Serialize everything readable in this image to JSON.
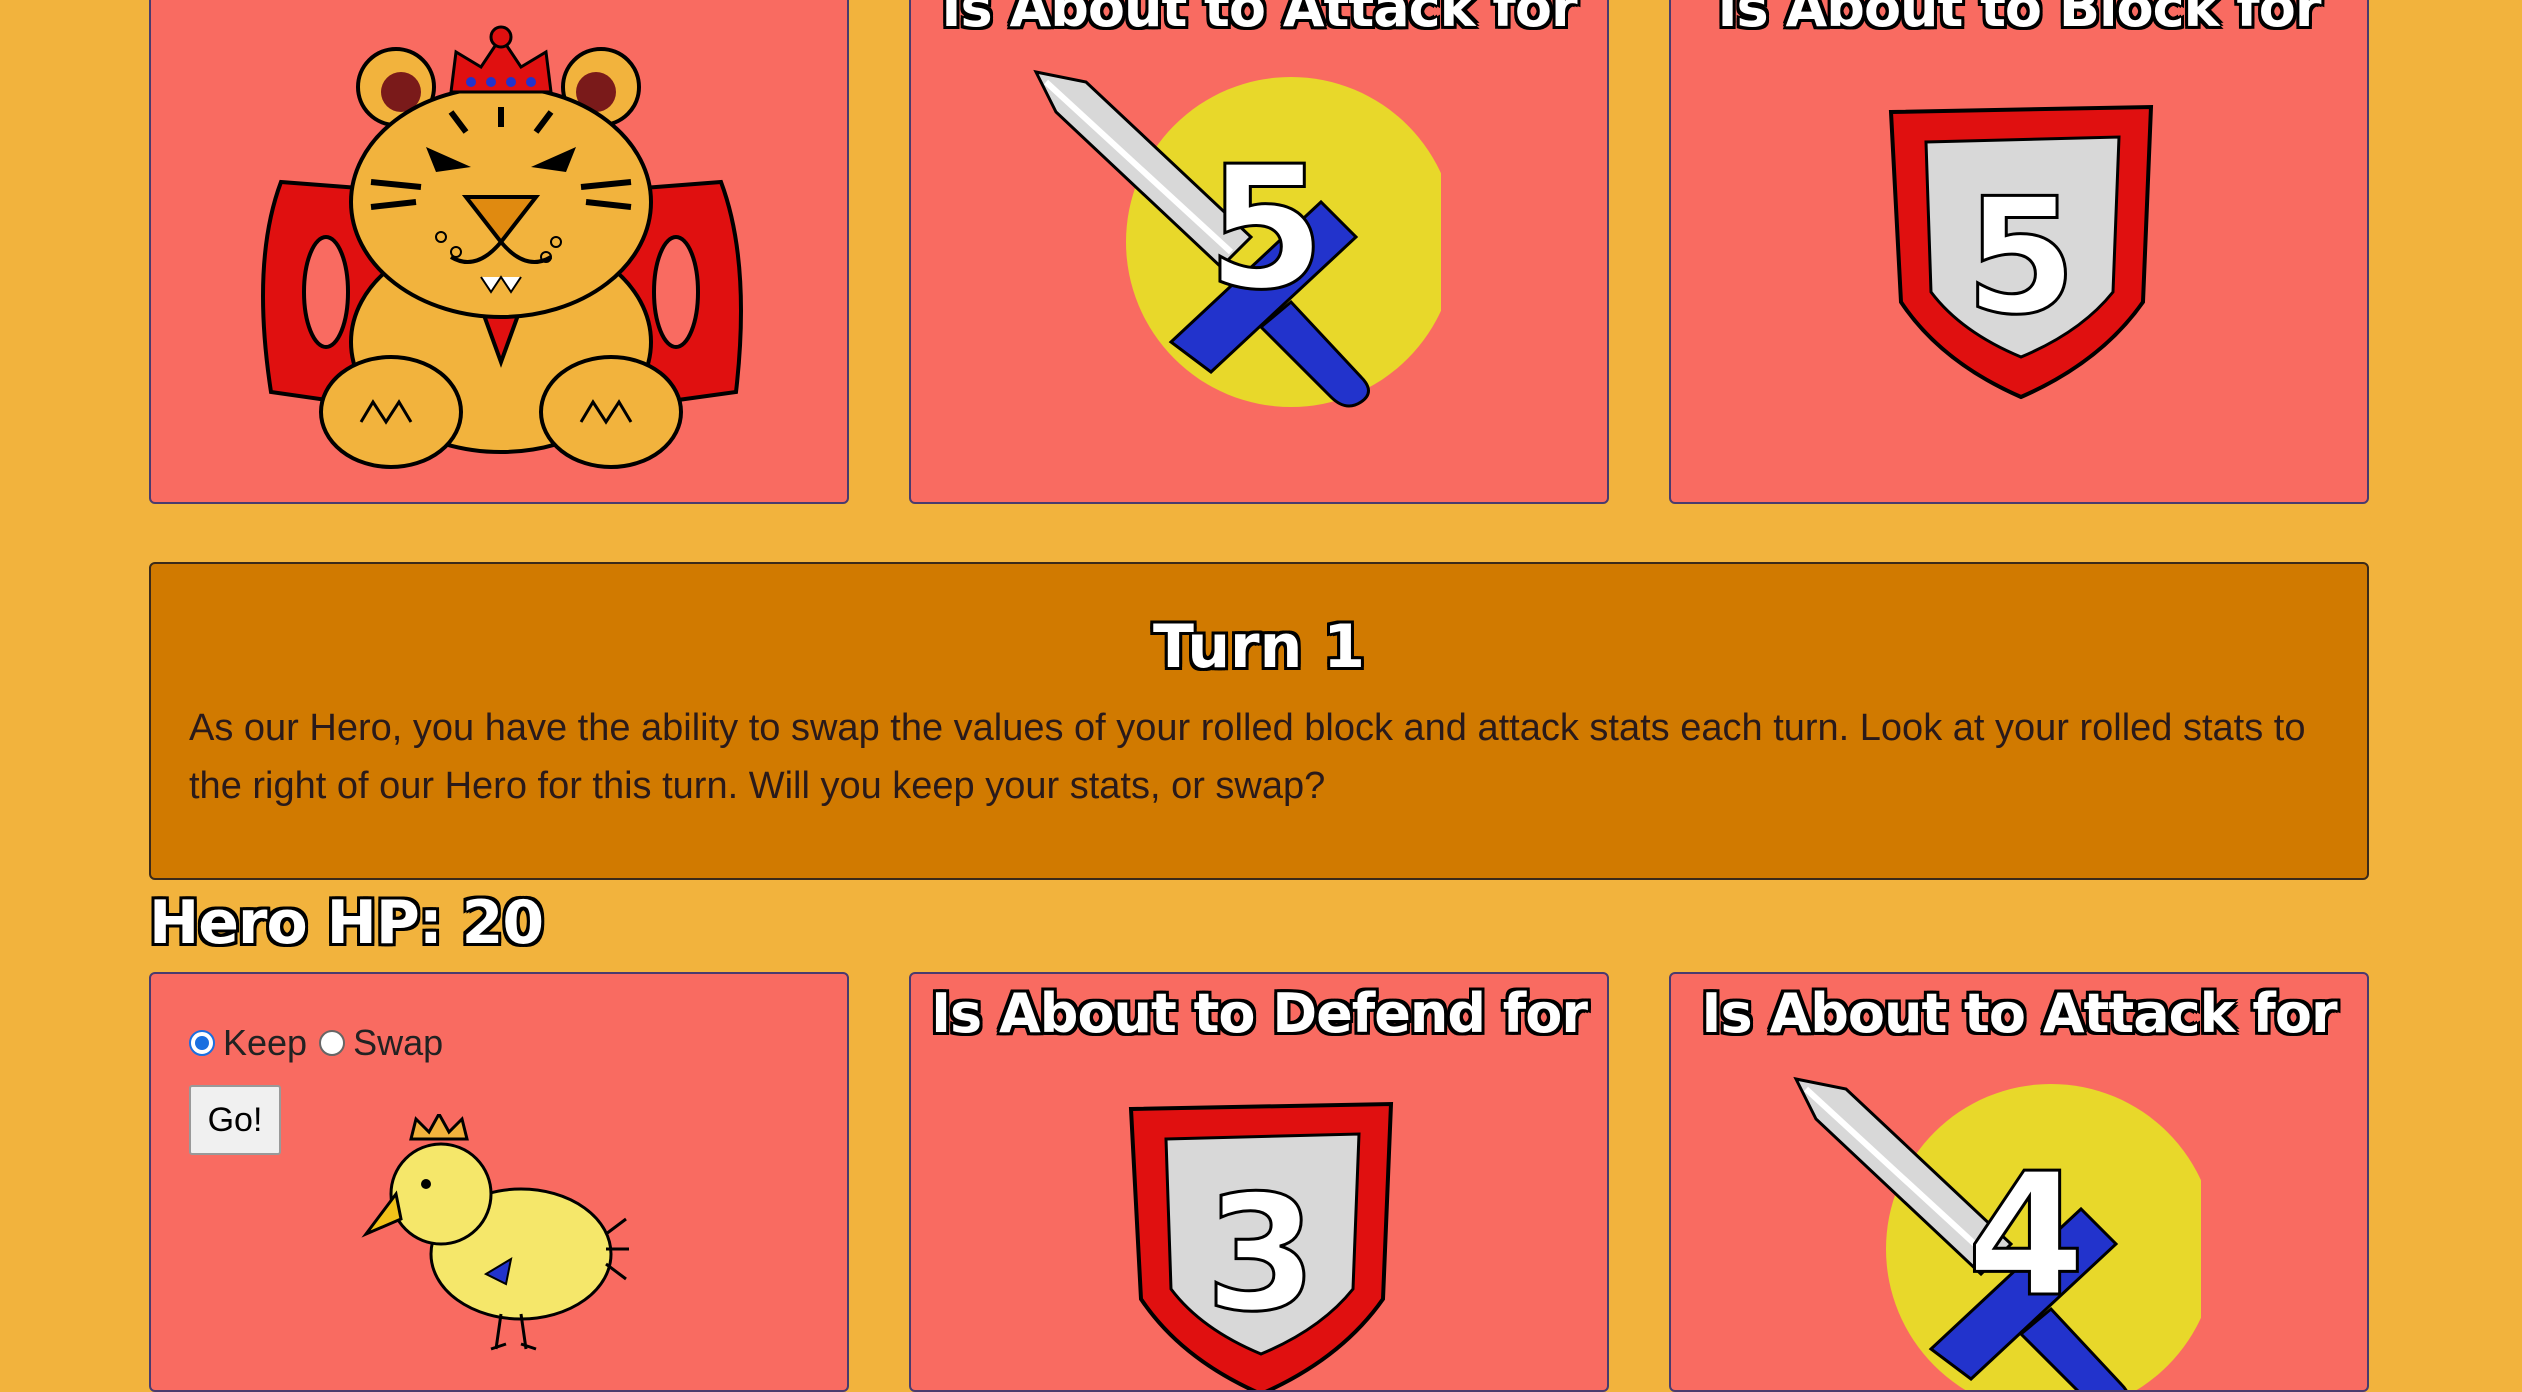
{
  "enemy": {
    "attack_title": "Is About to Attack for",
    "attack_value": "5",
    "block_title": "Is About to Block for",
    "block_value": "5"
  },
  "turn": {
    "title": "Turn 1",
    "text": "As our Hero, you have the ability to swap the values of your rolled block and attack stats each turn. Look at your rolled stats to the right of our Hero for this turn. Will you keep your stats, or swap?"
  },
  "hero": {
    "hp_label": "Hero HP: 20",
    "options": {
      "keep": "Keep",
      "swap": "Swap",
      "selected": "Keep"
    },
    "go_label": "Go!",
    "defend_title": "Is About to Defend for",
    "defend_value": "3",
    "attack_title": "Is About to Attack for",
    "attack_value": "4"
  },
  "colors": {
    "background": "#f2b33d",
    "card": "#f96b61",
    "panel": "#d17a00",
    "shield_red": "#e01010",
    "sword_blade": "#d8d8d8",
    "sword_hilt": "#2233cc",
    "attack_circle": "#e8d82a"
  },
  "icons": [
    "king-tiger-icon",
    "sword-icon",
    "shield-icon",
    "chick-hero-icon"
  ]
}
